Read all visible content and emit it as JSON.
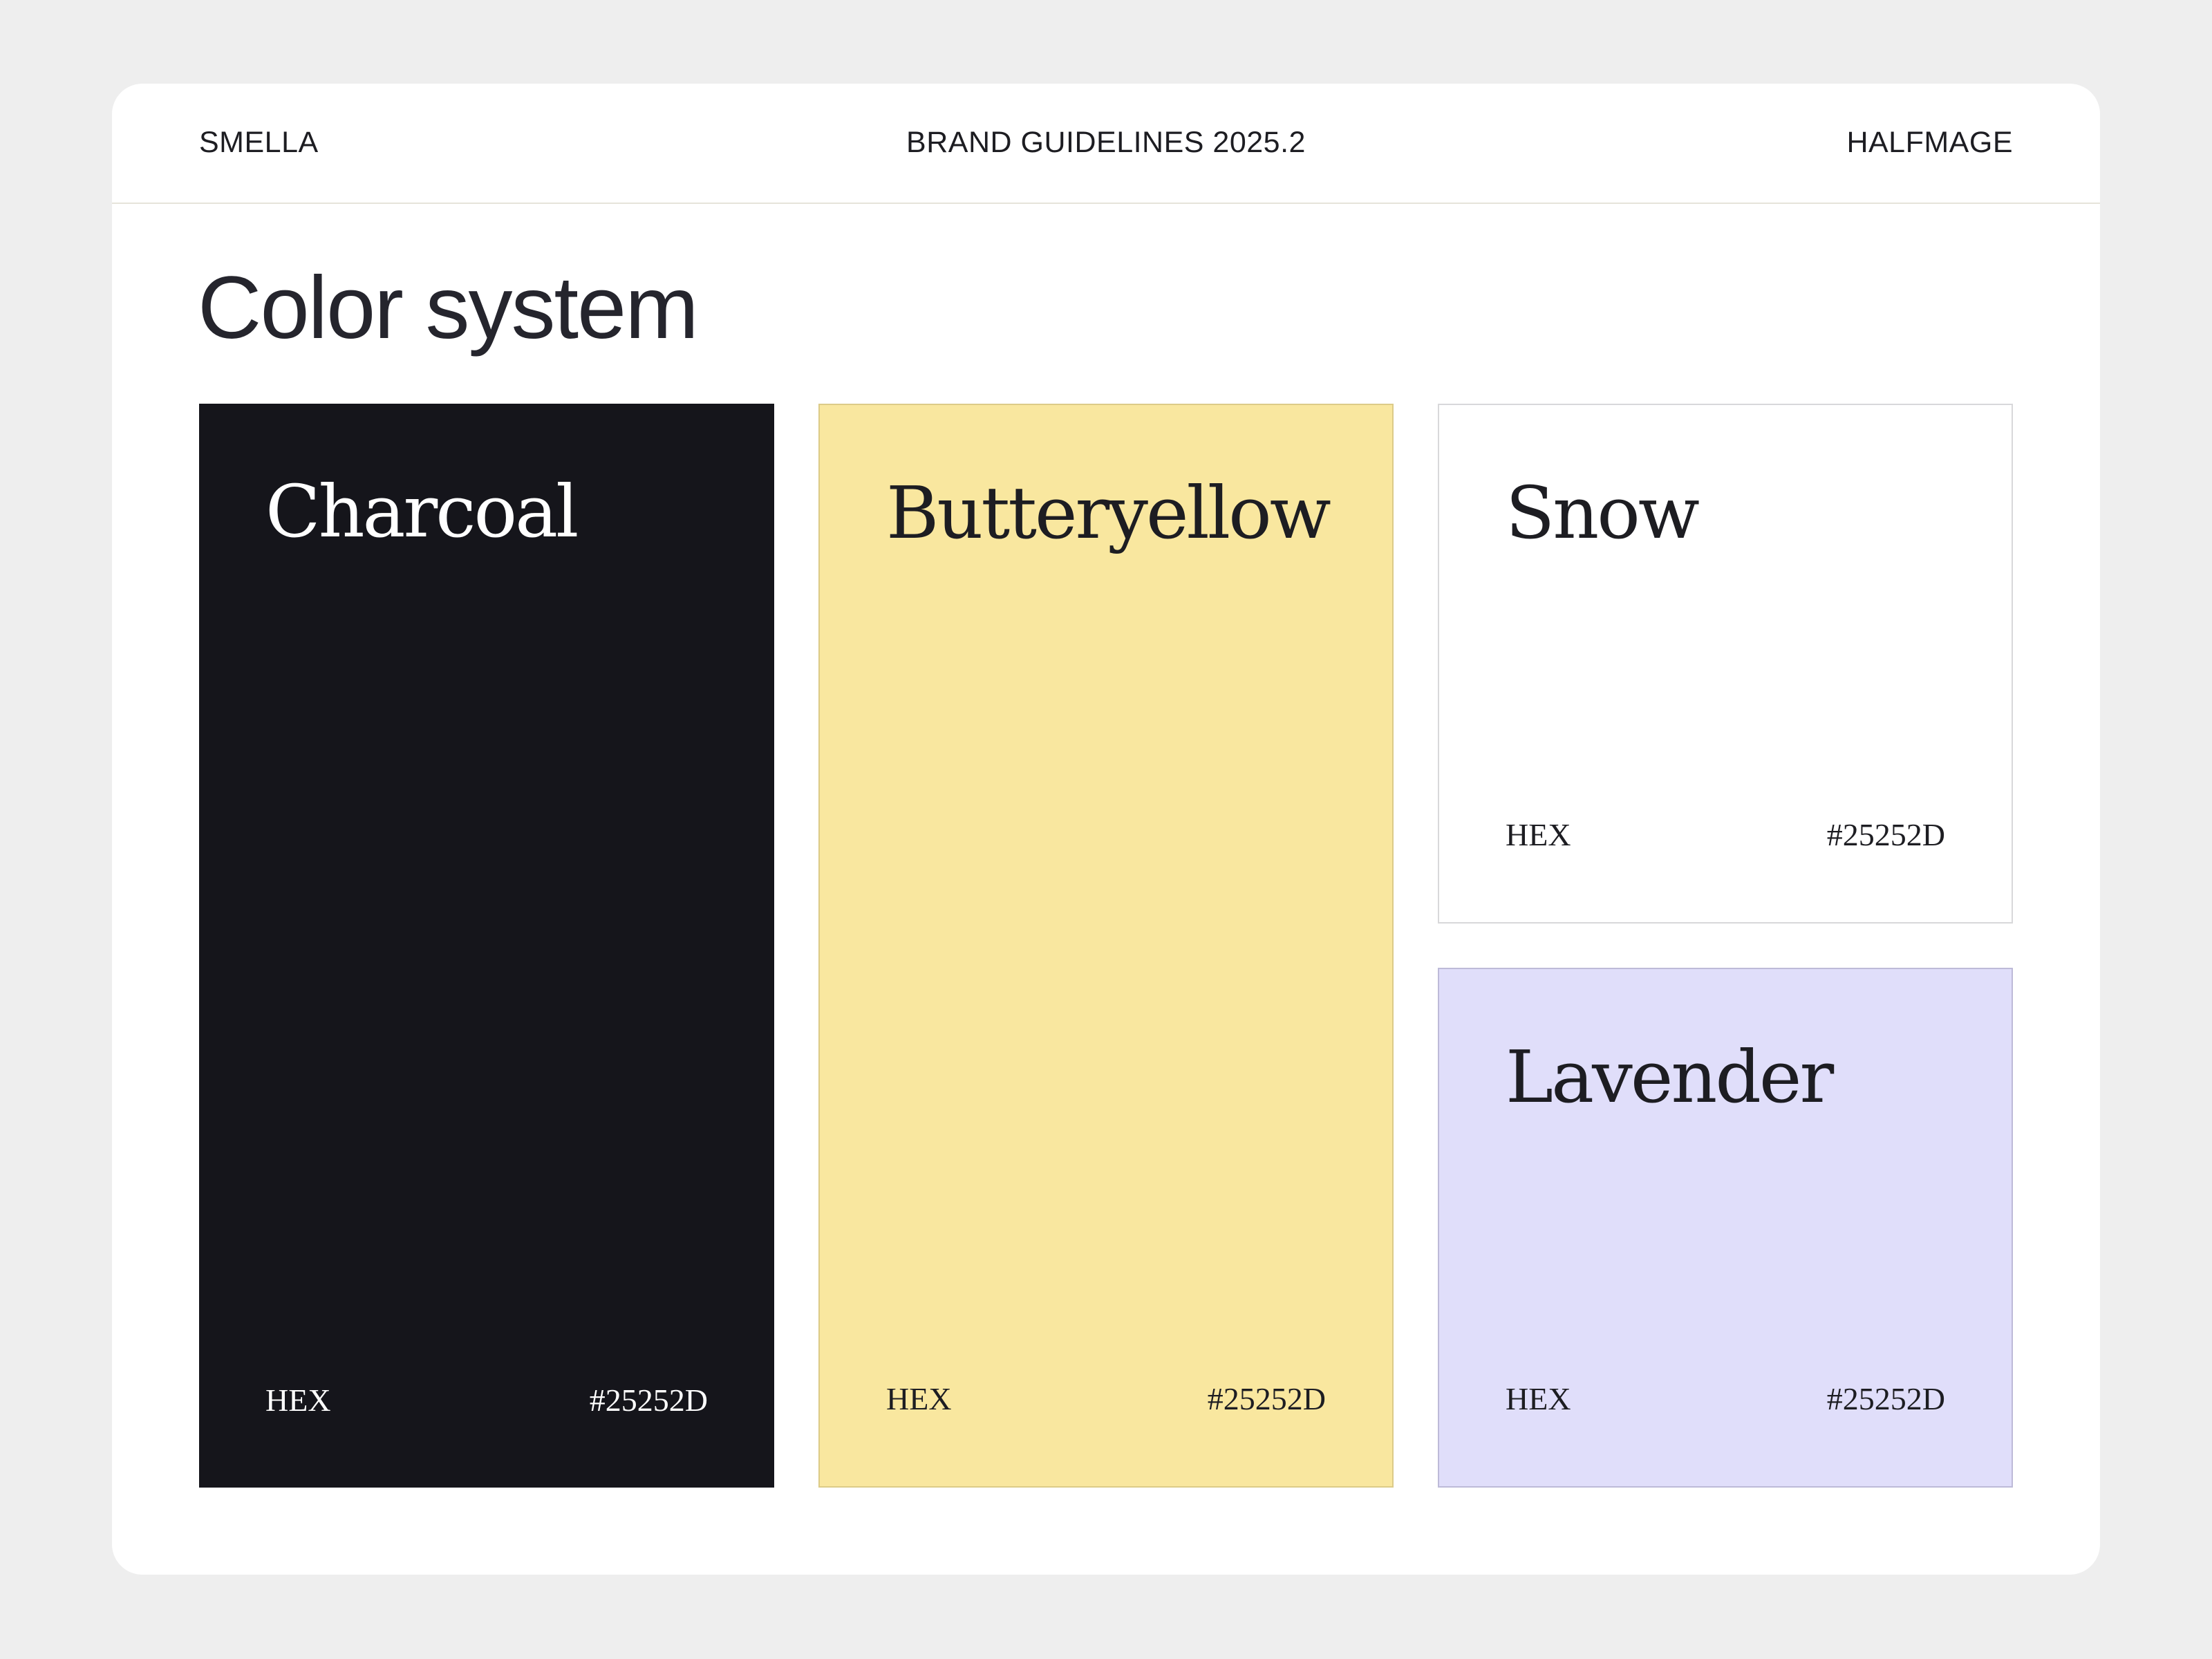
{
  "header": {
    "left": "SMELLA",
    "center": "BRAND GUIDELINES 2025.2",
    "right": "HALFMAGE"
  },
  "page": {
    "title": "Color system"
  },
  "swatches": [
    {
      "name": "Charcoal",
      "code_label": "HEX",
      "code_value": "#25252D",
      "fill": "#15151B"
    },
    {
      "name": "Butteryellow",
      "code_label": "HEX",
      "code_value": "#25252D",
      "fill": "#F9E79F"
    },
    {
      "name": "Snow",
      "code_label": "HEX",
      "code_value": "#25252D",
      "fill": "#FFFFFF"
    },
    {
      "name": "Lavender",
      "code_label": "HEX",
      "code_value": "#25252D",
      "fill": "#E0DEFA"
    }
  ]
}
